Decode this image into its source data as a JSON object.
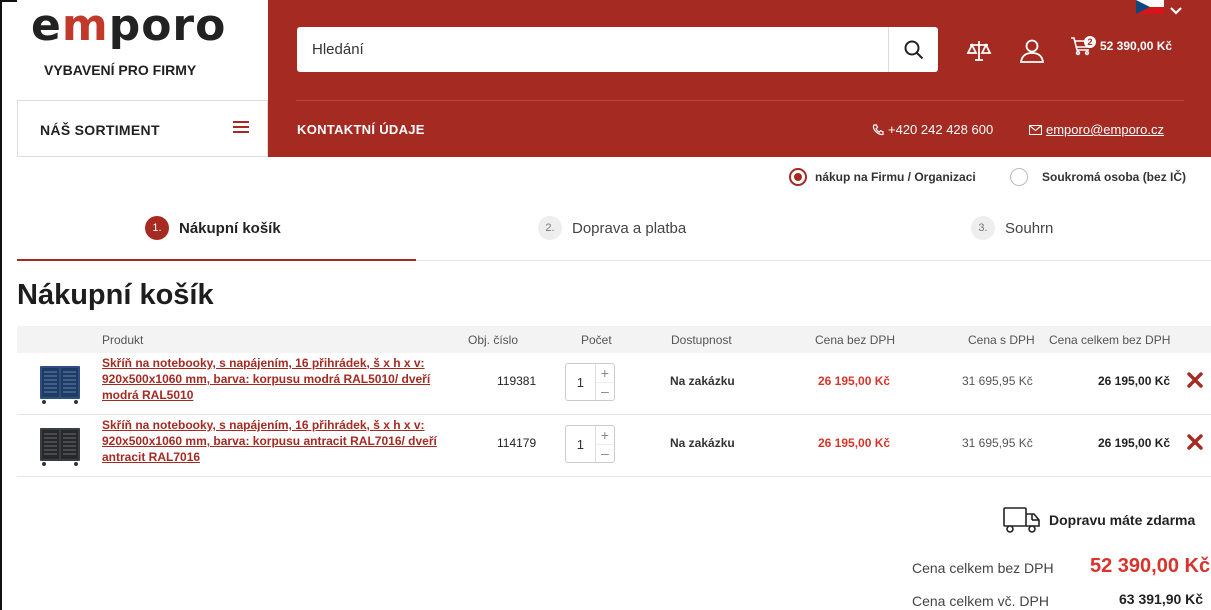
{
  "brand": {
    "logo": "emporo",
    "tagline": "VYBAVENÍ PRO FIRMY",
    "accent": "#a52a22"
  },
  "search": {
    "placeholder": "Hledání",
    "icon": "search-icon"
  },
  "header_icons": [
    "compare-icon",
    "user-icon",
    "cart-icon"
  ],
  "cart": {
    "count": "2",
    "total": "52 390,00 Kč"
  },
  "nav": {
    "assortment": "NÁŠ SORTIMENT",
    "contact": "KONTAKTNÍ ÚDAJE",
    "phone": "+420 242 428 600",
    "email": "emporo@emporo.cz"
  },
  "purchase_type": {
    "company": "nákup na Firmu / Organizaci",
    "private": "Soukromá osoba (bez IČ)",
    "selected": "company"
  },
  "steps": [
    {
      "num": "1.",
      "label": "Nákupní košík"
    },
    {
      "num": "2.",
      "label": "Doprava a platba"
    },
    {
      "num": "3.",
      "label": "Souhrn"
    }
  ],
  "page_title": "Nákupní košík",
  "table": {
    "headers": {
      "product": "Produkt",
      "code": "Obj. číslo",
      "qty": "Počet",
      "availability": "Dostupnost",
      "price_ex": "Cena bez DPH",
      "price_inc": "Cena s DPH",
      "total_ex": "Cena celkem bez DPH"
    },
    "rows": [
      {
        "name": "Skříň na notebooky, s napájením, 16 přihrádek, š x h x v: 920x500x1060 mm, barva: korpusu modrá RAL5010/ dveří modrá RAL5010",
        "code": "119381",
        "qty": "1",
        "availability": "Na zakázku",
        "price_ex": "26 195,00 Kč",
        "price_inc": "31 695,95 Kč",
        "total_ex": "26 195,00 Kč",
        "color": "#2a4f80"
      },
      {
        "name": "Skříň na notebooky, s napájením, 16 přihrádek, š x h x v: 920x500x1060 mm, barva: korpusu antracit RAL7016/ dveří antracit RAL7016",
        "code": "114179",
        "qty": "1",
        "availability": "Na zakázku",
        "price_ex": "26 195,00 Kč",
        "price_inc": "31 695,95 Kč",
        "total_ex": "26 195,00 Kč",
        "color": "#3a3d42"
      }
    ]
  },
  "summary": {
    "shipping": "Dopravu máte zdarma",
    "total_ex_label": "Cena celkem bez DPH",
    "total_ex": "52 390,00 Kč",
    "total_inc_label": "Cena celkem vč. DPH",
    "total_inc": "63 391,90 Kč"
  }
}
